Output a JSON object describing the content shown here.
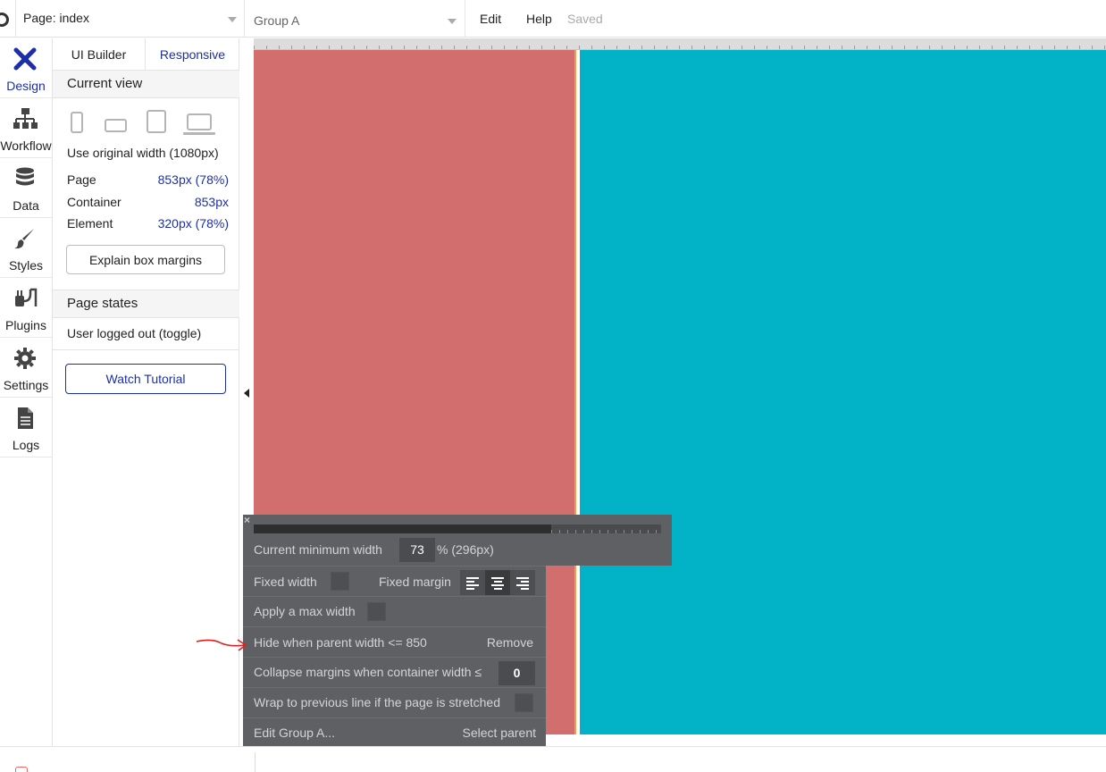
{
  "topbar": {
    "page_label": "Page: index",
    "element_label": "Group A",
    "menu_edit": "Edit",
    "menu_help": "Help",
    "status": "Saved"
  },
  "leftnav": {
    "items": [
      {
        "label": "Design",
        "icon": "design-icon",
        "active": true
      },
      {
        "label": "Workflow",
        "icon": "workflow-icon"
      },
      {
        "label": "Data",
        "icon": "database-icon"
      },
      {
        "label": "Styles",
        "icon": "brush-icon"
      },
      {
        "label": "Plugins",
        "icon": "plug-icon"
      },
      {
        "label": "Settings",
        "icon": "gear-icon"
      },
      {
        "label": "Logs",
        "icon": "document-icon"
      }
    ]
  },
  "panel": {
    "tabs": {
      "ui_builder": "UI Builder",
      "responsive": "Responsive"
    },
    "current_view_title": "Current view",
    "original_width": "Use original width (1080px)",
    "page_label": "Page",
    "page_value": "853px (78%)",
    "container_label": "Container",
    "container_value": "853px",
    "element_label": "Element",
    "element_value": "320px (78%)",
    "explain_button": "Explain box margins",
    "page_states_title": "Page states",
    "state_item": "User logged out (toggle)",
    "tutorial_button": "Watch Tutorial"
  },
  "popup": {
    "close_glyph": "×",
    "min_width_label": "Current minimum width",
    "min_width_value": "73",
    "min_width_suffix": "% (296px)",
    "fixed_width_label": "Fixed width",
    "fixed_margin_label": "Fixed margin",
    "max_width_label": "Apply a max width",
    "hide_label": "Hide when parent width <= 850",
    "remove_label": "Remove",
    "collapse_label": "Collapse margins when container width ≤",
    "collapse_value": "0",
    "wrap_label": "Wrap to previous line if the page is stretched",
    "edit_label": "Edit Group A...",
    "select_parent_label": "Select parent",
    "selected_alignment": "center"
  },
  "colors": {
    "accent": "#1d2fa8",
    "group_a": "#d26e6d",
    "group_b": "#02b3c7",
    "popup_bg": "#5f6063",
    "annotation": "#e02020"
  }
}
